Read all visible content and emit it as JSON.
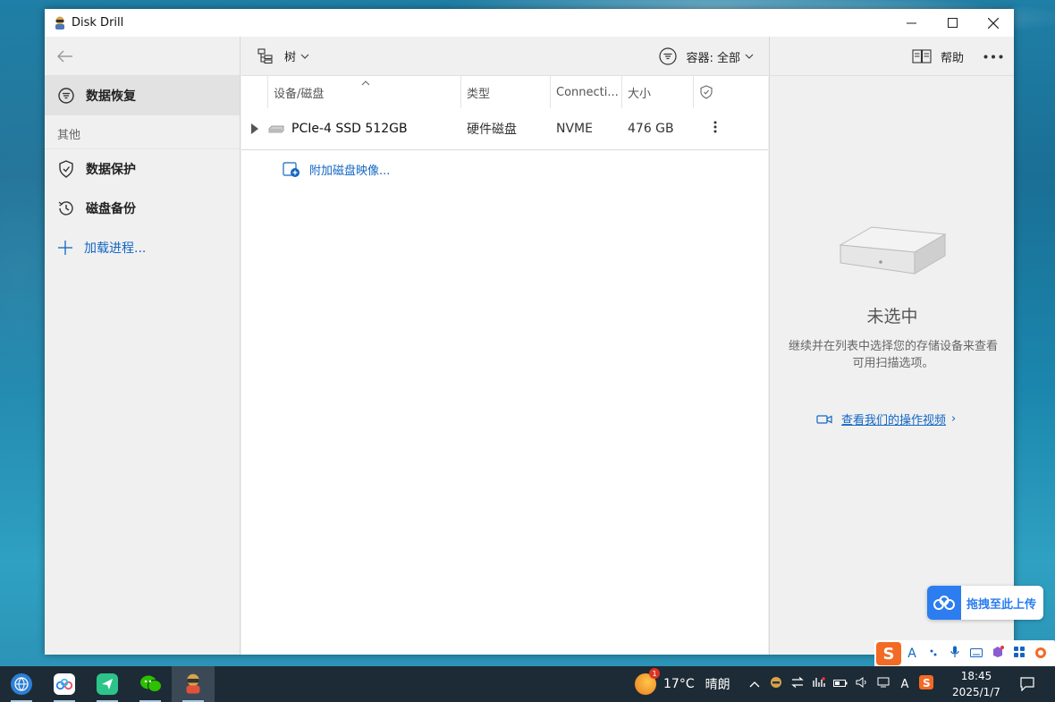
{
  "window": {
    "title": "Disk Drill",
    "controls": {
      "minimize": "—",
      "maximize": "☐",
      "close": "✕"
    }
  },
  "sidebar": {
    "back": "←",
    "active_item": "数据恢复",
    "section": "其他",
    "items": [
      {
        "label": "数据保护"
      },
      {
        "label": "磁盘备份"
      }
    ],
    "add_link": "加载进程..."
  },
  "toolbar": {
    "view_label": "树",
    "filter_label": "容器: 全部"
  },
  "table": {
    "columns": [
      "设备/磁盘",
      "类型",
      "Connecti...",
      "大小"
    ],
    "rows": [
      {
        "name": "PCIe-4 SSD 512GB",
        "type": "硬件磁盘",
        "connection": "NVME",
        "size": "476 GB"
      }
    ],
    "attach_label": "附加磁盘映像..."
  },
  "right_panel": {
    "help_label": "帮助",
    "more": "•••",
    "title": "未选中",
    "description": "继续并在列表中选择您的存储设备来查看可用扫描选项。",
    "video_link": "查看我们的操作视频",
    "video_chevron": "›"
  },
  "upload_widget": {
    "label": "拖拽至此上传"
  },
  "ime": {
    "letter": "A",
    "brand": "S"
  },
  "taskbar": {
    "weather_temp": "17°C",
    "weather_cond": "晴朗",
    "weather_badge": "1",
    "tray_input": "A",
    "time": "18:45",
    "date": "2025/1/7"
  },
  "colors": {
    "accent": "#1366c3",
    "window_bg": "#f0f0f0",
    "taskbar": "#1d2b36"
  }
}
